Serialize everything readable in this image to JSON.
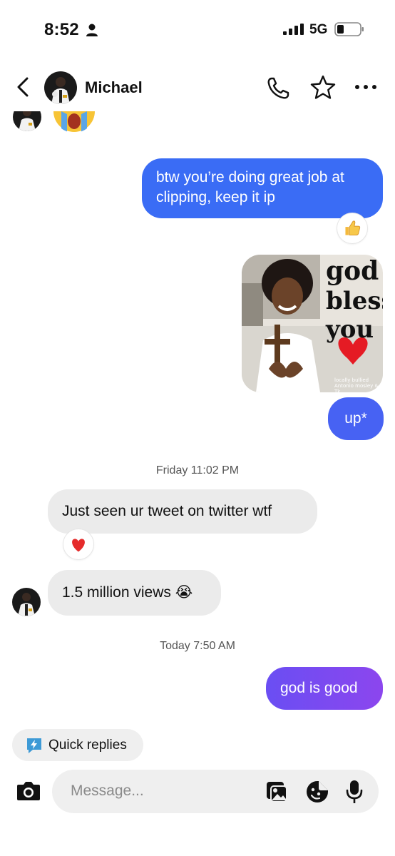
{
  "status_bar": {
    "time": "8:52",
    "network": "5G",
    "icons": [
      "person-icon",
      "signal-icon",
      "battery-icon"
    ]
  },
  "header": {
    "contact_name": "Michael",
    "icons": [
      "back-chevron-icon",
      "avatar",
      "phone-icon",
      "star-icon",
      "more-icon"
    ]
  },
  "messages": {
    "out_1": "btw you’re doing great job at clipping, keep it ip",
    "out_1_reaction": "👍",
    "image_caption_lines": [
      "god",
      "bless",
      "you"
    ],
    "image_watermark_1": "locally bullied",
    "image_watermark_2": "Antonio mosley & Tk",
    "out_2": "up*",
    "timestamp_1": "Friday 11:02 PM",
    "in_1": "Just seen ur tweet on twitter wtf",
    "in_1_reaction": "❤️",
    "in_2": "1.5 million views 😭",
    "timestamp_2": "Today 7:50 AM",
    "out_3": "god is good"
  },
  "quick_replies": {
    "label": "Quick replies"
  },
  "composer": {
    "placeholder": "Message..."
  },
  "colors": {
    "outgoing_blue": "#3a6cf5",
    "outgoing_purple": "#8c46ee",
    "incoming_gray": "#ebebeb",
    "quick_reply_icon": "#3d9ad6"
  }
}
